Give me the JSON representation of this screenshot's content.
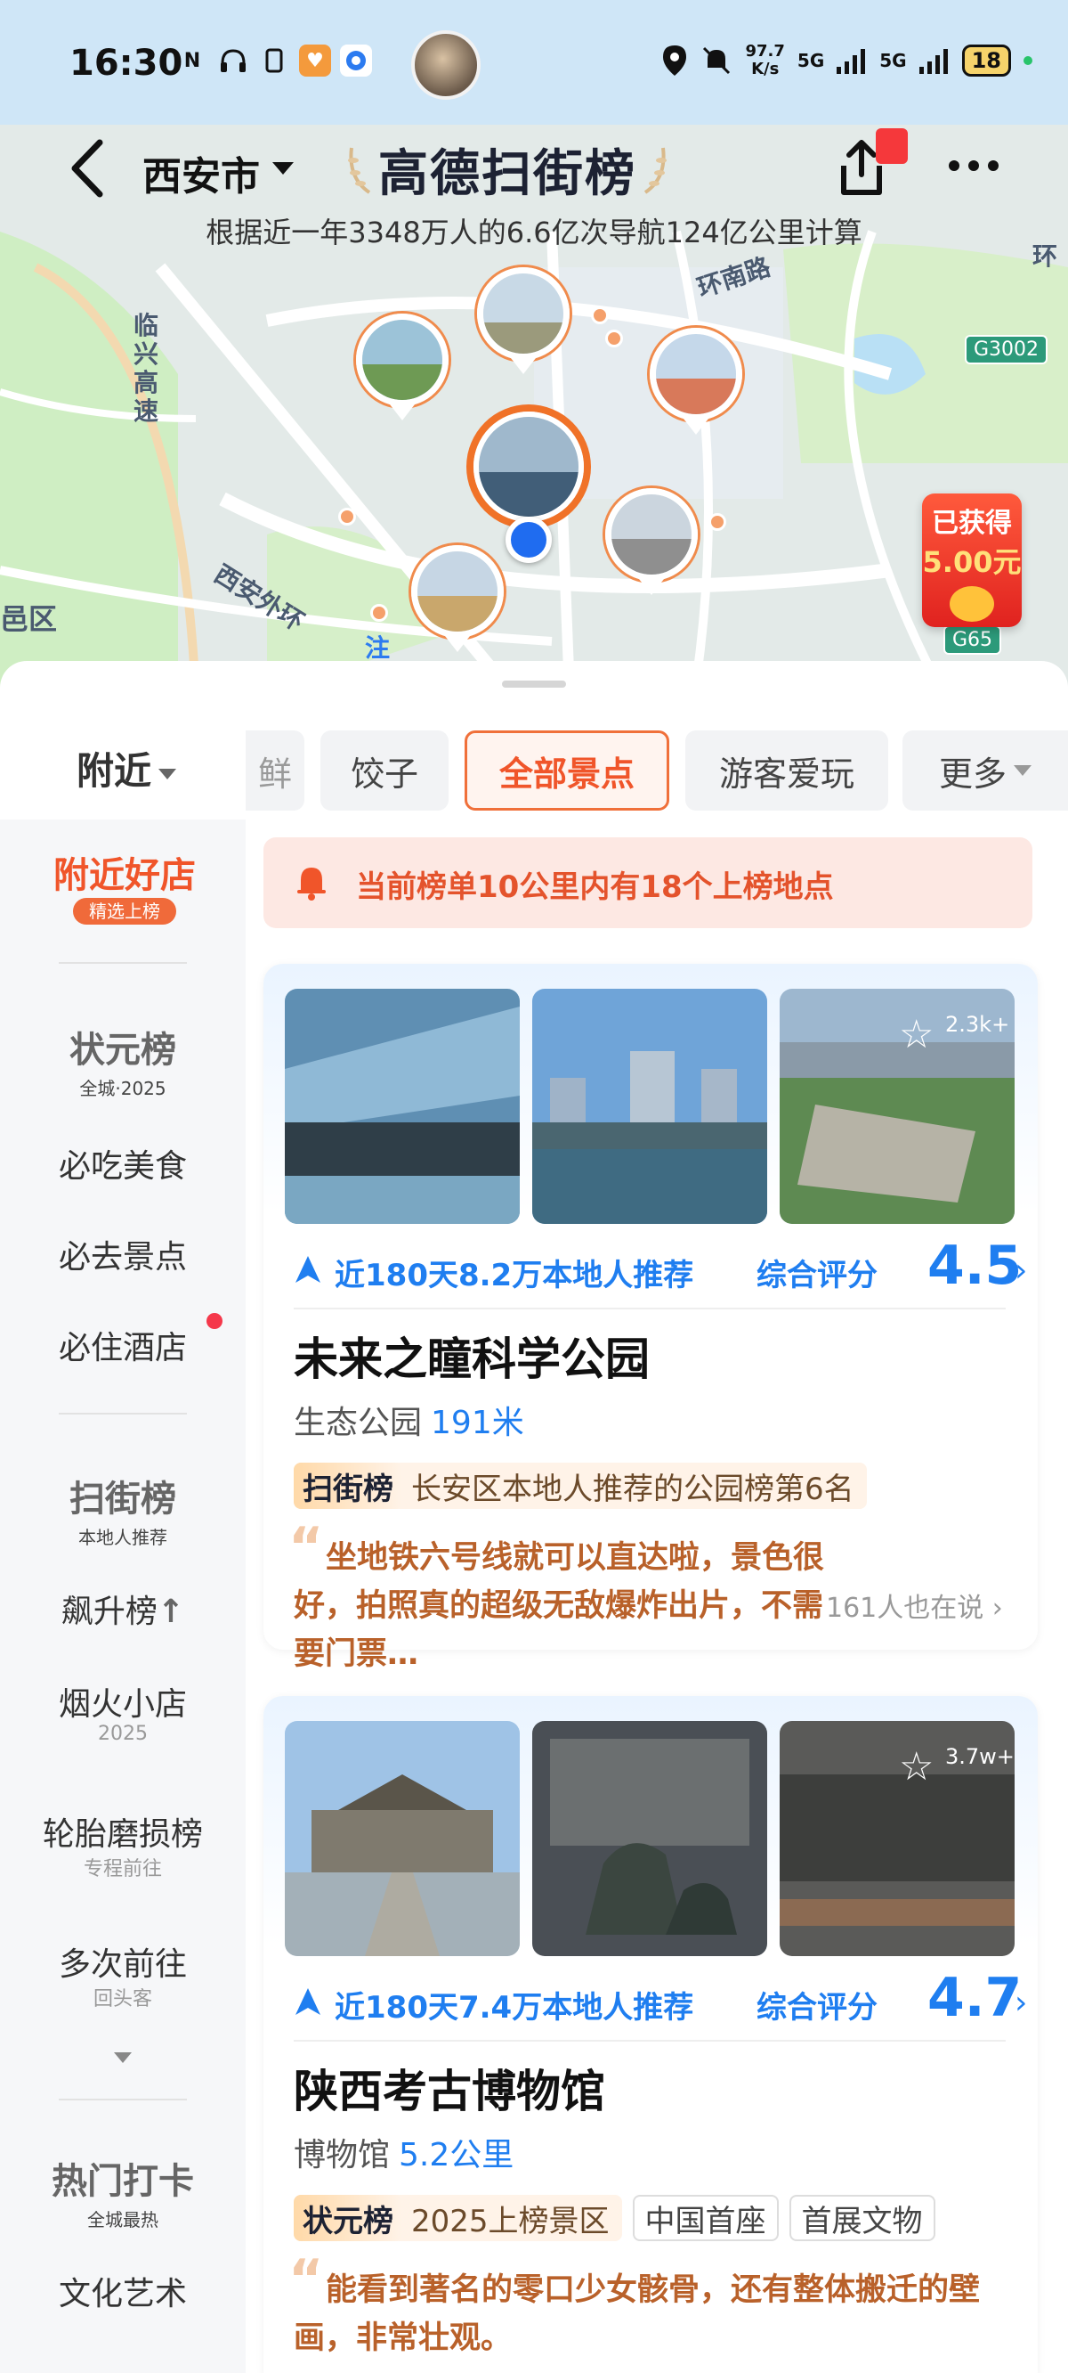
{
  "status_bar": {
    "time": "16:30",
    "net_speed_value": "97.7",
    "net_speed_unit": "K/s",
    "signal1": "5G",
    "signal2": "5G",
    "battery": "18"
  },
  "header": {
    "city": "西安市",
    "brand": "高德扫街榜",
    "subtitle": "根据近一年3348万人的6.6亿次导航124亿公里计算"
  },
  "map": {
    "labels": {
      "ring_south": "环南路",
      "linxing": "临兴高速",
      "xian_outer": "西安外环",
      "yiqu": "邑区",
      "huan": "环",
      "zhu": "注"
    },
    "shields": {
      "g3002": "G3002",
      "g65": "G65"
    },
    "redpacket": {
      "line1": "已获得",
      "line2": "5.00元"
    }
  },
  "tabs": {
    "nearby": "附近",
    "chips": [
      "鲜",
      "饺子",
      "全部景点",
      "游客爱玩",
      "更多"
    ],
    "active_index": 2
  },
  "sidebar": {
    "nearby_badge": {
      "title": "附近好店",
      "pill": "精选上榜"
    },
    "zhuangyuan": {
      "title": "状元榜",
      "sub": "全城·2025"
    },
    "items_a": [
      "必吃美食",
      "必去景点",
      "必住酒店"
    ],
    "saojie": {
      "title": "扫街榜",
      "sub": "本地人推荐"
    },
    "items_b": [
      {
        "label": "飙升榜",
        "sub": ""
      },
      {
        "label": "烟火小店",
        "sub": "2025"
      },
      {
        "label": "轮胎磨损榜",
        "sub": "专程前往"
      },
      {
        "label": "多次前往",
        "sub": "回头客"
      }
    ],
    "hot": {
      "title": "热门打卡",
      "sub": "全城最热"
    },
    "items_c": [
      "文化艺术"
    ]
  },
  "notice": {
    "text": "当前榜单10公里内有18个上榜地点"
  },
  "cards": [
    {
      "fav_count": "2.3k+",
      "rec": "近180天8.2万本地人推荐",
      "score_label": "综合评分",
      "score": "4.5",
      "title": "未来之瞳科学公园",
      "category": "生态公园",
      "distance": "191米",
      "rank_brand": "扫街榜",
      "rank_text": "长安区本地人推荐的公园榜第6名",
      "review": "坐地铁六号线就可以直达啦，景色很好，拍照真的超级无敌爆炸出片，不需要门票…",
      "review_meta": "161人也在说"
    },
    {
      "fav_count": "3.7w+",
      "rec": "近180天7.4万本地人推荐",
      "score_label": "综合评分",
      "score": "4.7",
      "title": "陕西考古博物馆",
      "category": "博物馆",
      "distance": "5.2公里",
      "rank_brand": "状元榜",
      "rank_text": "2025上榜景区",
      "tags": [
        "中国首座",
        "首展文物"
      ],
      "review": "能看到著名的零口少女骸骨，还有整体搬迁的壁画，非常壮观。"
    }
  ]
}
